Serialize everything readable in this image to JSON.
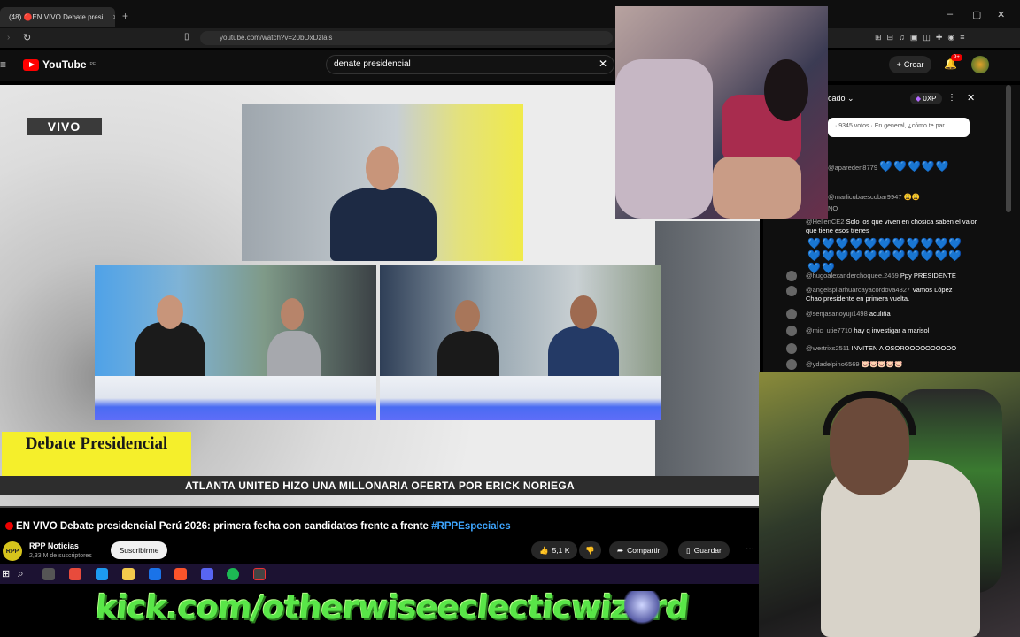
{
  "browser": {
    "tab_title": "(48) 🔴EN VIVO Debate presi...",
    "url": "youtube.com/watch?v=20bOxDzlais",
    "new_tab": "+",
    "minimize": "–",
    "maximize": "▢",
    "close": "✕"
  },
  "youtube": {
    "logo_text": "YouTube",
    "logo_region": "PE",
    "search_value": "denate presidencial",
    "create_label": "Crear",
    "notif_count": "9+"
  },
  "video": {
    "live_label": "VIVO",
    "lower_third": "Debate Presidencial",
    "ticker": "ATLANTA UNITED HIZO UNA MILLONARIA OFERTA POR ERICK NORIEGA",
    "title": "EN VIVO Debate presidencial Perú 2026: primera fecha con candidatos frente a frente",
    "hashtag": "#RPPEspeciales",
    "channel_name": "RPP Noticias",
    "channel_avatar": "RPP",
    "channel_subs": "2,33 M de suscriptores",
    "subscribe": "Suscribirme",
    "likes": "5,1 K",
    "share": "Compartir",
    "save": "Guardar",
    "more": "···"
  },
  "chat": {
    "header": "cado",
    "points": "0XP",
    "poll_text": "· 9345 votos · En general, ¿cómo te par...",
    "messages": [
      {
        "user": "@apareden8779",
        "text": "💙💙💙💙💙"
      },
      {
        "user": "@marlicubaescobar9947",
        "text": "😩😩"
      },
      {
        "user": "NO",
        "text": ""
      },
      {
        "user": "@HellenCE2",
        "text": "Solo los que viven en chosica saben el valor que tiene esos trenes"
      },
      {
        "user": "@hugoalexanderchoquee.2469",
        "text": "Ppy PRESIDENTE"
      },
      {
        "user": "@angelspilarhuarcayacordova4827",
        "text": "Vamos López Chao presidente en primera vuelta."
      },
      {
        "user": "@senjasanoyuji1498",
        "text": "aculiña"
      },
      {
        "user": "@mic_utie7710",
        "text": "hay q investigar a marisol"
      },
      {
        "user": "@wertrixs2511",
        "text": "INVITEN A OSOROOOOOOOOOO"
      },
      {
        "user": "@ydadelpino6569",
        "text": "🐷🐷🐷🐷🐷"
      }
    ]
  },
  "overlay": {
    "kick_url": "kick.com/otherwiseeclecticwizard"
  },
  "colors": {
    "yt_red": "#ff0000",
    "debate_yellow": "#f5ef2b",
    "kick_green": "#59e648",
    "hashtag_blue": "#3ea6ff"
  }
}
